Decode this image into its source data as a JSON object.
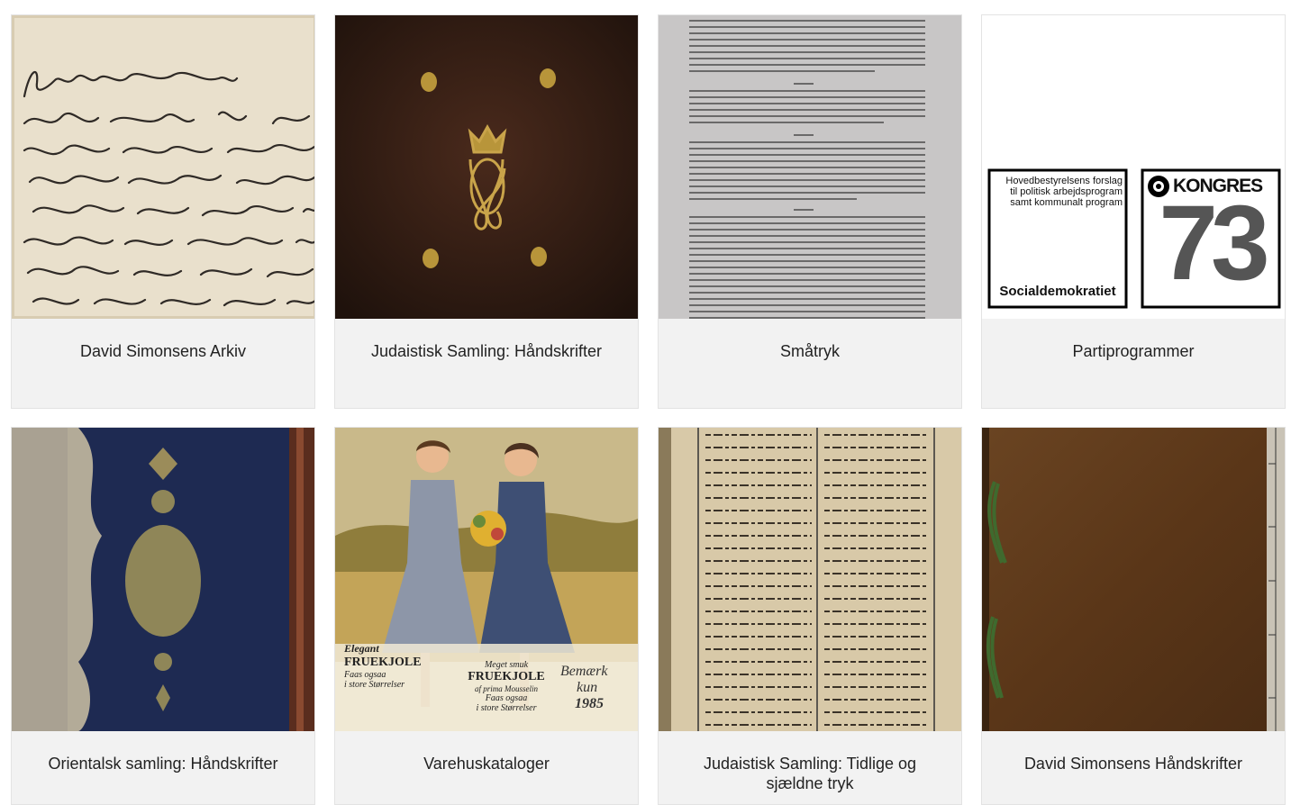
{
  "collections": [
    {
      "title": "David Simonsens Arkiv",
      "image": "handwritten-letter"
    },
    {
      "title": "Judaistisk Samling: Håndskrifter",
      "image": "leather-book-cover-monogram"
    },
    {
      "title": "Småtryk",
      "image": "printed-document-page"
    },
    {
      "title": "Partiprogrammer",
      "image": "party-program-covers",
      "overlay": {
        "left_cover_text": "Hovedbestyrelsens forslag til politisk arbejdsprogram samt kommunalt program",
        "left_cover_brand": "Socialdemokratiet",
        "right_cover_title": "KONGRES",
        "right_cover_number": "73"
      }
    },
    {
      "title": "Orientalsk samling: Håndskrifter",
      "image": "blue-ornate-manuscript-cover"
    },
    {
      "title": "Varehuskataloger",
      "image": "catalogue-cover-two-women",
      "overlay": {
        "left_ad_lines": [
          "Elegant",
          "FRUEKJOLE",
          "Faas ogsaa",
          "i store Størrelser"
        ],
        "middle_ad_lines": [
          "Meget smuk",
          "FRUEKJOLE",
          "af prima Mousselin",
          "Faas ogsaa",
          "i store Størrelser"
        ],
        "price_lines": [
          "Bemærk",
          "kun",
          "1985"
        ]
      }
    },
    {
      "title": "Judaistisk Samling: Tidlige og sjældne tryk",
      "image": "hebrew-printed-page"
    },
    {
      "title": "David Simonsens Håndskrifter",
      "image": "brown-leather-binding-with-ruler"
    }
  ]
}
